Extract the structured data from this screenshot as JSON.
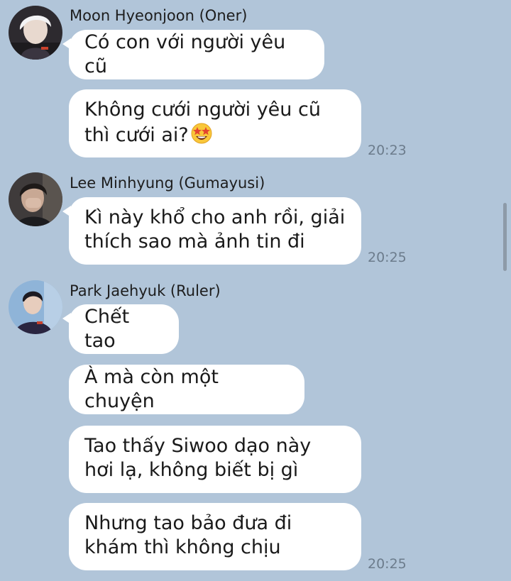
{
  "messages": [
    {
      "sender": "Moon Hyeonjoon (Oner)",
      "bubbles": [
        "Có con với người yêu cũ",
        "Không cưới người yêu cũ thì cưới ai?"
      ],
      "emoji": "star-struck-emoji",
      "time": "20:23"
    },
    {
      "sender": "Lee Minhyung (Gumayusi)",
      "bubbles": [
        "Kì này khổ cho anh rồi, giải thích sao mà ảnh tin đi"
      ],
      "time": "20:25"
    },
    {
      "sender": "Park Jaehyuk (Ruler)",
      "bubbles": [
        "Chết tao",
        "À mà còn một chuyện",
        "Tao thấy Siwoo dạo này hơi lạ, không biết bị gì",
        "Nhưng tao bảo đưa đi khám thì không chịu"
      ],
      "time": "20:25"
    }
  ],
  "colors": {
    "background": "#b1c5d9",
    "bubble": "#ffffff",
    "timestamp": "#6c7c8c"
  }
}
